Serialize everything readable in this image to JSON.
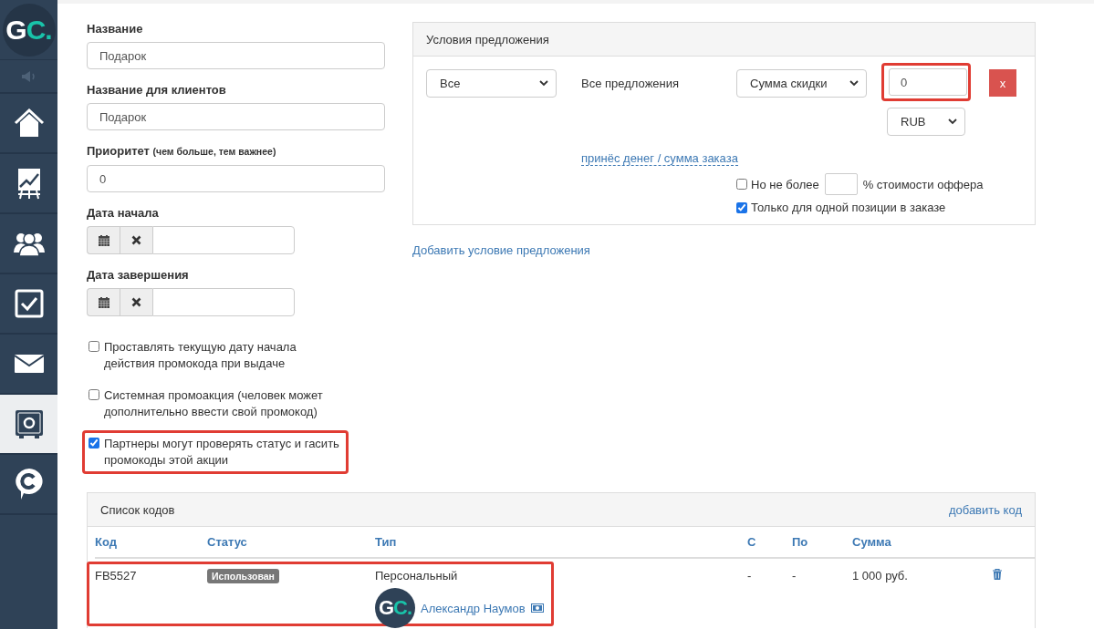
{
  "sidebar": {
    "logo": "GC.",
    "items": [
      {
        "kind": "speaker",
        "selected": false
      },
      {
        "kind": "home",
        "selected": false
      },
      {
        "kind": "chart",
        "selected": false
      },
      {
        "kind": "people",
        "selected": false
      },
      {
        "kind": "check",
        "selected": false
      },
      {
        "kind": "mail",
        "selected": false
      },
      {
        "kind": "safe",
        "selected": true
      },
      {
        "kind": "chat",
        "selected": false
      }
    ]
  },
  "form": {
    "fields": [
      {
        "label": "Название",
        "value": "Подарок"
      },
      {
        "label": "Название для клиентов",
        "value": "Подарок"
      },
      {
        "label": "Приоритет",
        "hint": "(чем больше, тем важнее)",
        "value": "0"
      }
    ],
    "dates": [
      {
        "label": "Дата начала"
      },
      {
        "label": "Дата завершения"
      }
    ],
    "checkboxes": [
      {
        "label": "Проставлять текущую дату начала действия промокода при выдаче",
        "checked": false,
        "highlighted": false
      },
      {
        "label": "Системная промоакция (человек может дополнительно ввести свой промокод)",
        "checked": false,
        "highlighted": false
      },
      {
        "label": "Партнеры могут проверять статус и гасить промокоды этой акции",
        "checked": true,
        "highlighted": true
      }
    ]
  },
  "offer": {
    "title": "Условия предложения",
    "scope_select": "Все",
    "scope_text": "Все предложения",
    "type_select": "Сумма скидки",
    "amount": {
      "value": "0",
      "highlighted": true
    },
    "remove_button": "x",
    "currency_select": "RUB",
    "formula_link": "принёс денег / сумма заказа",
    "options": [
      {
        "kind": "limit",
        "label": "Но не более",
        "suffix": "% стоимости оффера",
        "checked": false
      },
      {
        "kind": "plain",
        "label": "Только для одной позиции в заказе",
        "checked": true
      }
    ]
  },
  "add_condition_link": "Добавить условие предложения",
  "codes": {
    "title": "Список кодов",
    "add_link": "добавить код",
    "columns": [
      "Код",
      "Статус",
      "Тип",
      "С",
      "По",
      "Сумма"
    ],
    "rows": [
      {
        "code": "FB5527",
        "status": "Использован",
        "type": "Персональный",
        "user": {
          "avatar": "GC.",
          "name": "Александр Наумов"
        },
        "from": "-",
        "to": "-",
        "amount": "1 000 руб.",
        "highlighted": true
      }
    ]
  }
}
